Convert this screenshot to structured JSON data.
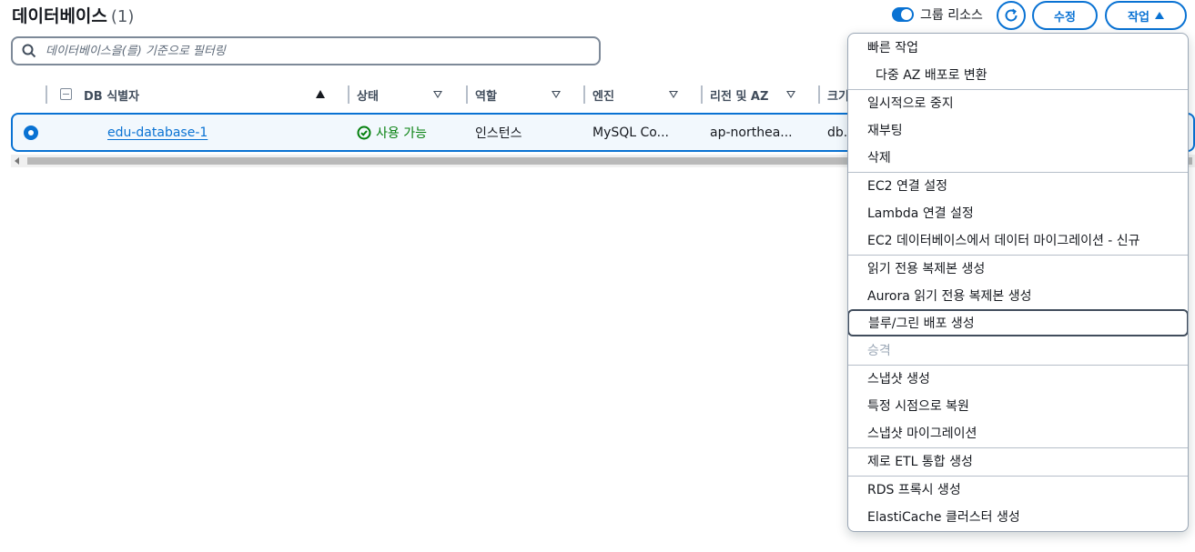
{
  "header": {
    "title": "데이터베이스",
    "count": "(1)",
    "group_toggle_label": "그룹 리소스",
    "edit_button": "수정",
    "actions_button": "작업"
  },
  "search": {
    "placeholder": "데이터베이스을(를) 기준으로 필터링"
  },
  "table": {
    "columns": [
      "DB 식별자",
      "상태",
      "역할",
      "엔진",
      "리전 및 AZ",
      "크기"
    ],
    "rows": [
      {
        "identifier": "edu-database-1",
        "status": "사용 가능",
        "role": "인스턴스",
        "engine": "MySQL Co...",
        "region": "ap-northea...",
        "size": "db.t"
      }
    ]
  },
  "menu": {
    "items": [
      {
        "label": "빠른 작업"
      },
      {
        "label": "다중 AZ 배포로 변환"
      },
      {
        "label": "일시적으로 중지"
      },
      {
        "label": "재부팅"
      },
      {
        "label": "삭제"
      },
      {
        "label": "EC2 연결 설정"
      },
      {
        "label": "Lambda 연결 설정"
      },
      {
        "label": "EC2 데이터베이스에서 데이터 마이그레이션 - 신규"
      },
      {
        "label": "읽기 전용 복제본 생성"
      },
      {
        "label": "Aurora 읽기 전용 복제본 생성"
      },
      {
        "label": "블루/그린 배포 생성"
      },
      {
        "label": "승격"
      },
      {
        "label": "스냅샷 생성"
      },
      {
        "label": "특정 시점으로 복원"
      },
      {
        "label": "스냅샷 마이그레이션"
      },
      {
        "label": "제로 ETL 통합 생성"
      },
      {
        "label": "RDS 프록시 생성"
      },
      {
        "label": "ElastiCache 클러스터 생성"
      }
    ]
  },
  "colors": {
    "accent": "#0972d3",
    "success": "#037f0c",
    "disabled": "#9ba7b6"
  }
}
